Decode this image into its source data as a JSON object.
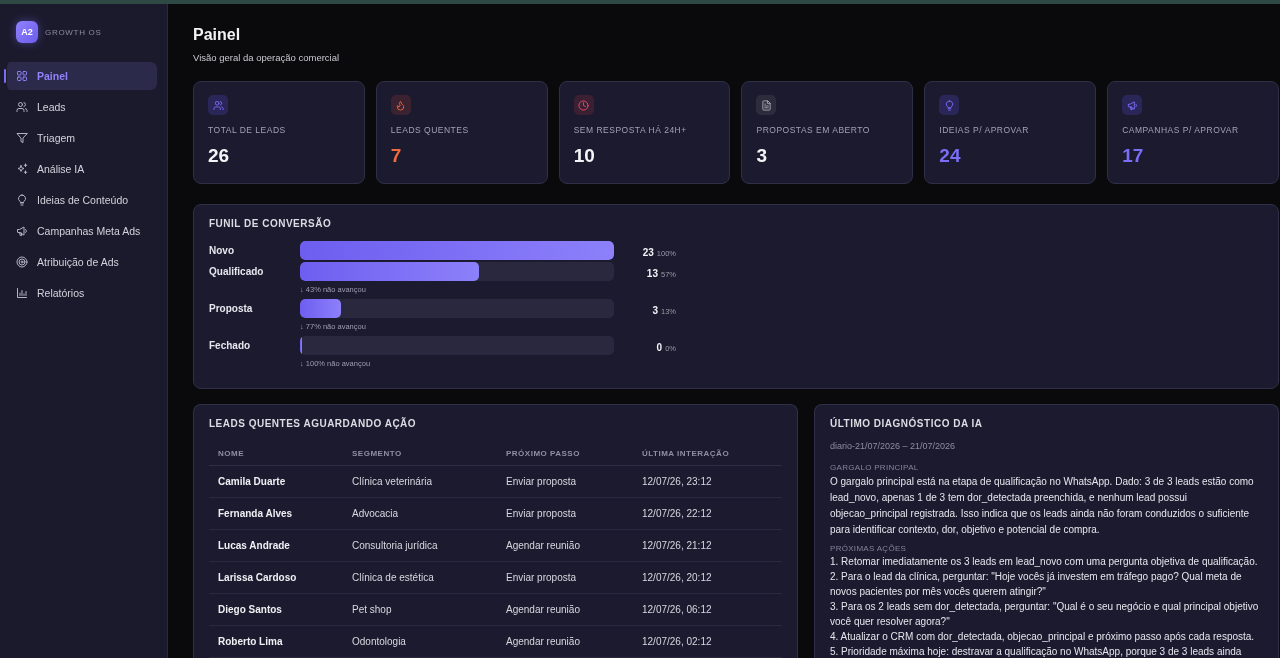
{
  "sidebar": {
    "brand": {
      "logo": "A2",
      "name": "GROWTH OS"
    },
    "items": [
      {
        "label": "Painel",
        "kind": "dashboard",
        "selected": true
      },
      {
        "label": "Leads",
        "kind": "leads",
        "selected": false
      },
      {
        "label": "Triagem",
        "kind": "triage",
        "selected": false
      },
      {
        "label": "Análise IA",
        "kind": "analysis",
        "selected": false
      },
      {
        "label": "Ideias de Conteúdo",
        "kind": "ideas",
        "selected": false
      },
      {
        "label": "Campanhas Meta Ads",
        "kind": "campaigns",
        "selected": false
      },
      {
        "label": "Atribuição de Ads",
        "kind": "attribution",
        "selected": false
      },
      {
        "label": "Relatórios",
        "kind": "reports",
        "selected": false
      }
    ]
  },
  "header": {
    "title": "Painel",
    "subtitle": "Visão geral da operação comercial"
  },
  "kpis": [
    {
      "kind": "total",
      "label": "TOTAL DE LEADS",
      "value": "26"
    },
    {
      "kind": "hot",
      "label": "LEADS QUENTES",
      "value": "7"
    },
    {
      "kind": "stale",
      "label": "SEM RESPOSTA HÁ 24H+",
      "value": "10"
    },
    {
      "kind": "proposals",
      "label": "PROPOSTAS EM ABERTO",
      "value": "3"
    },
    {
      "kind": "ideas",
      "label": "IDEIAS P/ APROVAR",
      "value": "24"
    },
    {
      "kind": "campaigns",
      "label": "CAMPANHAS P/ APROVAR",
      "value": "17"
    }
  ],
  "funnel": {
    "title": "FUNIL DE CONVERSÃO",
    "stages": [
      {
        "label": "Novo",
        "level": 1,
        "count": "23",
        "percent": "100%"
      },
      {
        "label": "Qualificado",
        "level": 0.57,
        "count": "13",
        "percent": "57%",
        "drop": "↓ 43% não avançou"
      },
      {
        "label": "Proposta",
        "level": 0.13,
        "count": "3",
        "percent": "13%",
        "drop": "↓ 77% não avançou"
      },
      {
        "label": "Fechado",
        "level": 0,
        "count": "0",
        "percent": "0%",
        "drop": "↓ 100% não avançou"
      }
    ]
  },
  "hot_leads": {
    "title": "LEADS QUENTES AGUARDANDO AÇÃO",
    "columns": [
      "NOME",
      "SEGMENTO",
      "PRÓXIMO PASSO",
      "ÚLTIMA INTERAÇÃO"
    ],
    "rows": [
      [
        "Camila Duarte",
        "Clínica veterinária",
        "Enviar proposta",
        "12/07/26, 23:12"
      ],
      [
        "Fernanda Alves",
        "Advocacia",
        "Enviar proposta",
        "12/07/26, 22:12"
      ],
      [
        "Lucas Andrade",
        "Consultoria jurídica",
        "Agendar reunião",
        "12/07/26, 21:12"
      ],
      [
        "Larissa Cardoso",
        "Clínica de estética",
        "Enviar proposta",
        "12/07/26, 20:12"
      ],
      [
        "Diego Santos",
        "Pet shop",
        "Agendar reunião",
        "12/07/26, 06:12"
      ],
      [
        "Roberto Lima",
        "Odontologia",
        "Agendar reunião",
        "12/07/26, 02:12"
      ]
    ]
  },
  "diagnosis": {
    "title": "ÚLTIMO DIAGNÓSTICO DA IA",
    "period": "diario-21/07/2026 – 21/07/2026",
    "bottleneck": {
      "heading": "GARGALO PRINCIPAL",
      "text": "O gargalo principal está na etapa de qualificação no WhatsApp. Dado: 3 de 3 leads estão como lead_novo, apenas 1 de 3 tem dor_detectada preenchida, e nenhum lead possui objecao_principal registrada. Isso indica que os leads ainda não foram conduzidos o suficiente para identificar contexto, dor, objetivo e potencial de compra."
    },
    "next_actions": {
      "heading": "PRÓXIMAS AÇÕES",
      "items": [
        "1. Retomar imediatamente os 3 leads em lead_novo com uma pergunta objetiva de qualificação.",
        "2. Para o lead da clínica, perguntar: \"Hoje vocês já investem em tráfego pago? Qual meta de novos pacientes por mês vocês querem atingir?\"",
        "3. Para os 2 leads sem dor_detectada, perguntar: \"Qual é o seu negócio e qual principal objetivo você quer resolver agora?\"",
        "4. Atualizar o CRM com dor_detectada, objecao_principal e próximo passo após cada resposta.",
        "5. Prioridade máxima hoje: destravar a qualificação no WhatsApp, porque 3 de 3 leads ainda"
      ]
    }
  }
}
